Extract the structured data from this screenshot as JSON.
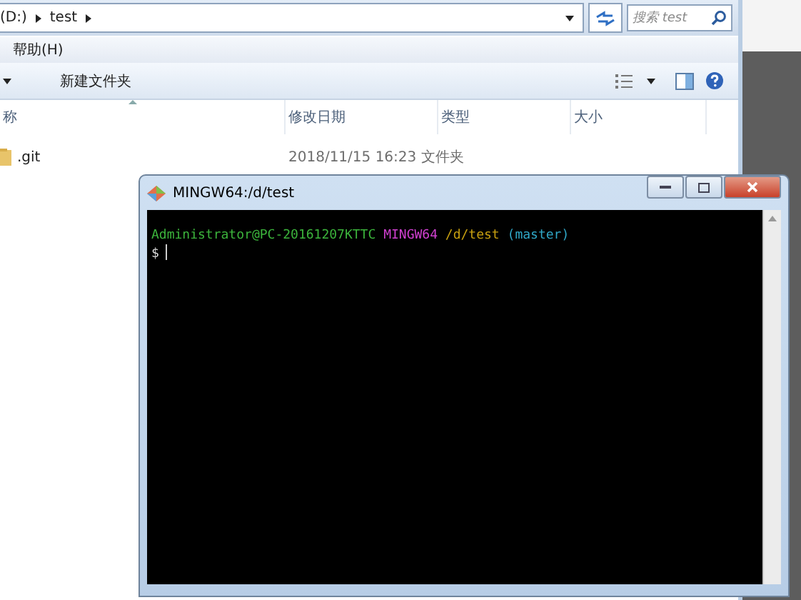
{
  "explorer": {
    "breadcrumb": [
      {
        "label": "(D:)"
      },
      {
        "label": "test"
      }
    ],
    "search": {
      "placeholder": "搜索 test"
    },
    "menu": [
      "帮助(H)"
    ],
    "toolbar": {
      "new_folder": "新建文件夹"
    },
    "columns": [
      "称",
      "修改日期",
      "类型",
      "大小"
    ],
    "rows": [
      {
        "name": ".git",
        "modified": "2018/11/15 16:23",
        "type": "文件夹"
      }
    ]
  },
  "terminal": {
    "title": "MINGW64:/d/test",
    "prompt": {
      "user": "Administrator@PC-20161207KTTC",
      "system": "MINGW64",
      "path": "/d/test",
      "branch": "(master)"
    },
    "input_line": "$"
  }
}
